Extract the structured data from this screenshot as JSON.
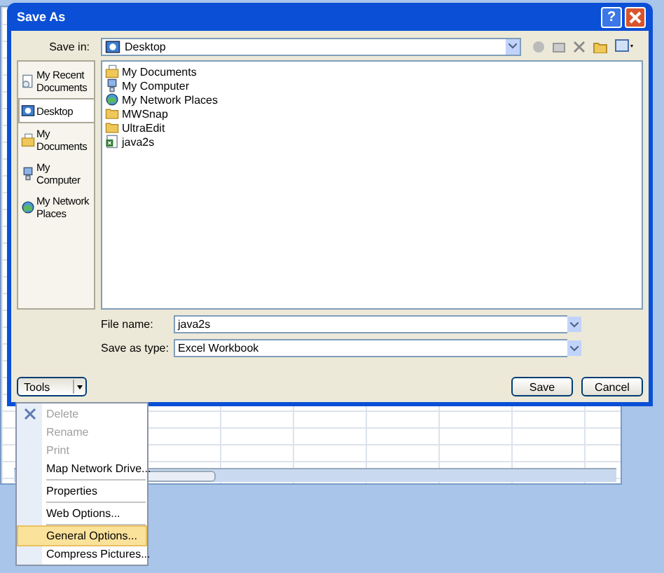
{
  "window": {
    "title": "Save As",
    "help": "?"
  },
  "save_in": {
    "label": "Save in:",
    "value": "Desktop"
  },
  "places": [
    {
      "label": "My Recent Documents",
      "kind": "recent",
      "selected": false
    },
    {
      "label": "Desktop",
      "kind": "desktop",
      "selected": true
    },
    {
      "label": "My Documents",
      "kind": "documents",
      "selected": false
    },
    {
      "label": "My Computer",
      "kind": "computer",
      "selected": false
    },
    {
      "label": "My Network Places",
      "kind": "network",
      "selected": false
    }
  ],
  "files": [
    {
      "name": "My Documents",
      "kind": "documents"
    },
    {
      "name": "My Computer",
      "kind": "computer"
    },
    {
      "name": "My Network Places",
      "kind": "network"
    },
    {
      "name": "MWSnap",
      "kind": "folder"
    },
    {
      "name": "UltraEdit",
      "kind": "folder"
    },
    {
      "name": "java2s",
      "kind": "workbook"
    }
  ],
  "file_name": {
    "label": "File name:",
    "value": "java2s"
  },
  "save_as_type": {
    "label": "Save as type:",
    "value": "Excel Workbook"
  },
  "buttons": [
    "Save",
    "Cancel"
  ],
  "tools": {
    "label": "Tools",
    "expanded": true
  },
  "menu": [
    [
      {
        "label": "Delete",
        "kind": "delete",
        "disabled": true,
        "selected": false
      },
      {
        "label": "Rename",
        "kind": "plain",
        "disabled": true,
        "selected": false
      },
      {
        "label": "Print",
        "kind": "plain",
        "disabled": true,
        "selected": false
      },
      {
        "label": "Map Network Drive...",
        "kind": "plain",
        "disabled": false,
        "selected": false
      }
    ],
    [
      {
        "label": "Properties",
        "kind": "plain",
        "disabled": false,
        "selected": false
      }
    ],
    [
      {
        "label": "Web Options...",
        "kind": "plain",
        "disabled": false,
        "selected": false
      }
    ],
    [
      {
        "label": "General Options...",
        "kind": "plain",
        "disabled": false,
        "selected": true
      },
      {
        "label": "Compress Pictures...",
        "kind": "plain",
        "disabled": false,
        "selected": false
      }
    ]
  ]
}
